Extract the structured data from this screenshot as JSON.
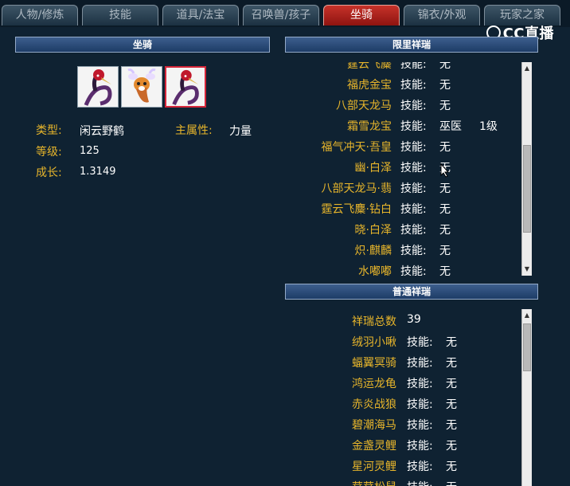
{
  "tabs": [
    {
      "label": "人物/修炼",
      "active": false
    },
    {
      "label": "技能",
      "active": false
    },
    {
      "label": "道具/法宝",
      "active": false
    },
    {
      "label": "召唤兽/孩子",
      "active": false
    },
    {
      "label": "坐骑",
      "active": true
    },
    {
      "label": "锦衣/外观",
      "active": false
    },
    {
      "label": "玩家之家",
      "active": false
    }
  ],
  "watermark": "CC直播",
  "mount_panel": {
    "title": "坐骑",
    "slots": [
      {
        "icon": "crane-mount-icon",
        "selected": false
      },
      {
        "icon": "deer-mount-icon",
        "selected": false
      },
      {
        "icon": "crane-mount-icon",
        "selected": true
      }
    ],
    "type_label": "类型:",
    "type_value": "闲云野鹤",
    "attr_label": "主属性:",
    "attr_value": "力量",
    "level_label": "等级:",
    "level_value": "125",
    "growth_label": "成长:",
    "growth_value": "1.3149"
  },
  "limited": {
    "title": "限里祥瑞",
    "rows": [
      {
        "name": "霆云飞麋",
        "skill_label": "技能:",
        "skill": "无",
        "level": ""
      },
      {
        "name": "福虎金宝",
        "skill_label": "技能:",
        "skill": "无",
        "level": ""
      },
      {
        "name": "八部天龙马",
        "skill_label": "技能:",
        "skill": "无",
        "level": ""
      },
      {
        "name": "霜雪龙宝",
        "skill_label": "技能:",
        "skill": "巫医",
        "level": "1级"
      },
      {
        "name": "福气冲天·吾皇",
        "skill_label": "技能:",
        "skill": "无",
        "level": ""
      },
      {
        "name": "幽·白泽",
        "skill_label": "技能:",
        "skill": "无",
        "level": ""
      },
      {
        "name": "八部天龙马·翡",
        "skill_label": "技能:",
        "skill": "无",
        "level": ""
      },
      {
        "name": "霆云飞麋·钻白",
        "skill_label": "技能:",
        "skill": "无",
        "level": ""
      },
      {
        "name": "晓·白泽",
        "skill_label": "技能:",
        "skill": "无",
        "level": ""
      },
      {
        "name": "炽·麒麟",
        "skill_label": "技能:",
        "skill": "无",
        "level": ""
      },
      {
        "name": "水嘟嘟",
        "skill_label": "技能:",
        "skill": "无",
        "level": ""
      }
    ]
  },
  "normal": {
    "title": "普通祥瑞",
    "total_label": "祥瑞总数",
    "total_value": "39",
    "rows": [
      {
        "name": "绒羽小啾",
        "skill_label": "技能:",
        "skill": "无"
      },
      {
        "name": "蝠翼冥骑",
        "skill_label": "技能:",
        "skill": "无"
      },
      {
        "name": "鸿运龙龟",
        "skill_label": "技能:",
        "skill": "无"
      },
      {
        "name": "赤炎战狼",
        "skill_label": "技能:",
        "skill": "无"
      },
      {
        "name": "碧潮海马",
        "skill_label": "技能:",
        "skill": "无"
      },
      {
        "name": "金盏灵鲤",
        "skill_label": "技能:",
        "skill": "无"
      },
      {
        "name": "星河灵鲤",
        "skill_label": "技能:",
        "skill": "无"
      },
      {
        "name": "茸茸松鼠",
        "skill_label": "技能:",
        "skill": "无"
      }
    ]
  }
}
